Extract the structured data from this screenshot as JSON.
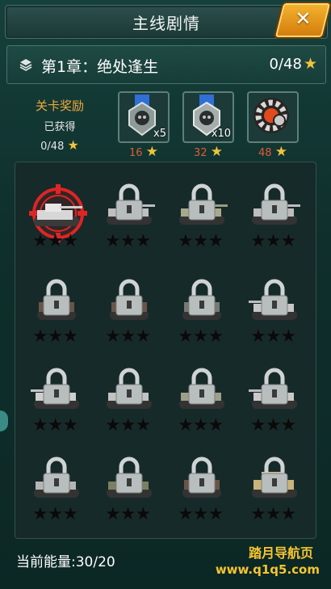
{
  "header": {
    "title": "主线剧情",
    "close_icon": "close-icon"
  },
  "chapter": {
    "title": "第1章：绝处逢生",
    "progress": "0/48",
    "star_glyph": "★"
  },
  "rewards": {
    "label": "关卡奖励",
    "status": "已获得",
    "count": "0/48",
    "items": [
      {
        "name": "medal-skull-blue",
        "multiplier": "x5",
        "required": "16"
      },
      {
        "name": "medal-skull-silver",
        "multiplier": "x10",
        "required": "32"
      },
      {
        "name": "gear-token",
        "multiplier": "",
        "required": "48"
      }
    ]
  },
  "levels": [
    {
      "state": "current",
      "stars": "★★★"
    },
    {
      "state": "locked",
      "stars": "★★★"
    },
    {
      "state": "locked",
      "stars": "★★★"
    },
    {
      "state": "locked",
      "stars": "★★★"
    },
    {
      "state": "locked",
      "stars": "★★★"
    },
    {
      "state": "locked",
      "stars": "★★★"
    },
    {
      "state": "locked",
      "stars": "★★★"
    },
    {
      "state": "locked",
      "stars": "★★★"
    },
    {
      "state": "locked",
      "stars": "★★★"
    },
    {
      "state": "locked",
      "stars": "★★★"
    },
    {
      "state": "locked",
      "stars": "★★★"
    },
    {
      "state": "locked",
      "stars": "★★★"
    },
    {
      "state": "locked",
      "stars": "★★★"
    },
    {
      "state": "locked",
      "stars": "★★★"
    },
    {
      "state": "locked",
      "stars": "★★★"
    },
    {
      "state": "locked",
      "stars": "★★★"
    }
  ],
  "footer": {
    "energy": "当前能量:30/20",
    "watermark_line1": "踏月导航页",
    "watermark_line2": "www.q1q5.com"
  },
  "colors": {
    "accent": "#f2c23c",
    "panel": "#162a2a",
    "reward_req": "#e05a3a"
  }
}
